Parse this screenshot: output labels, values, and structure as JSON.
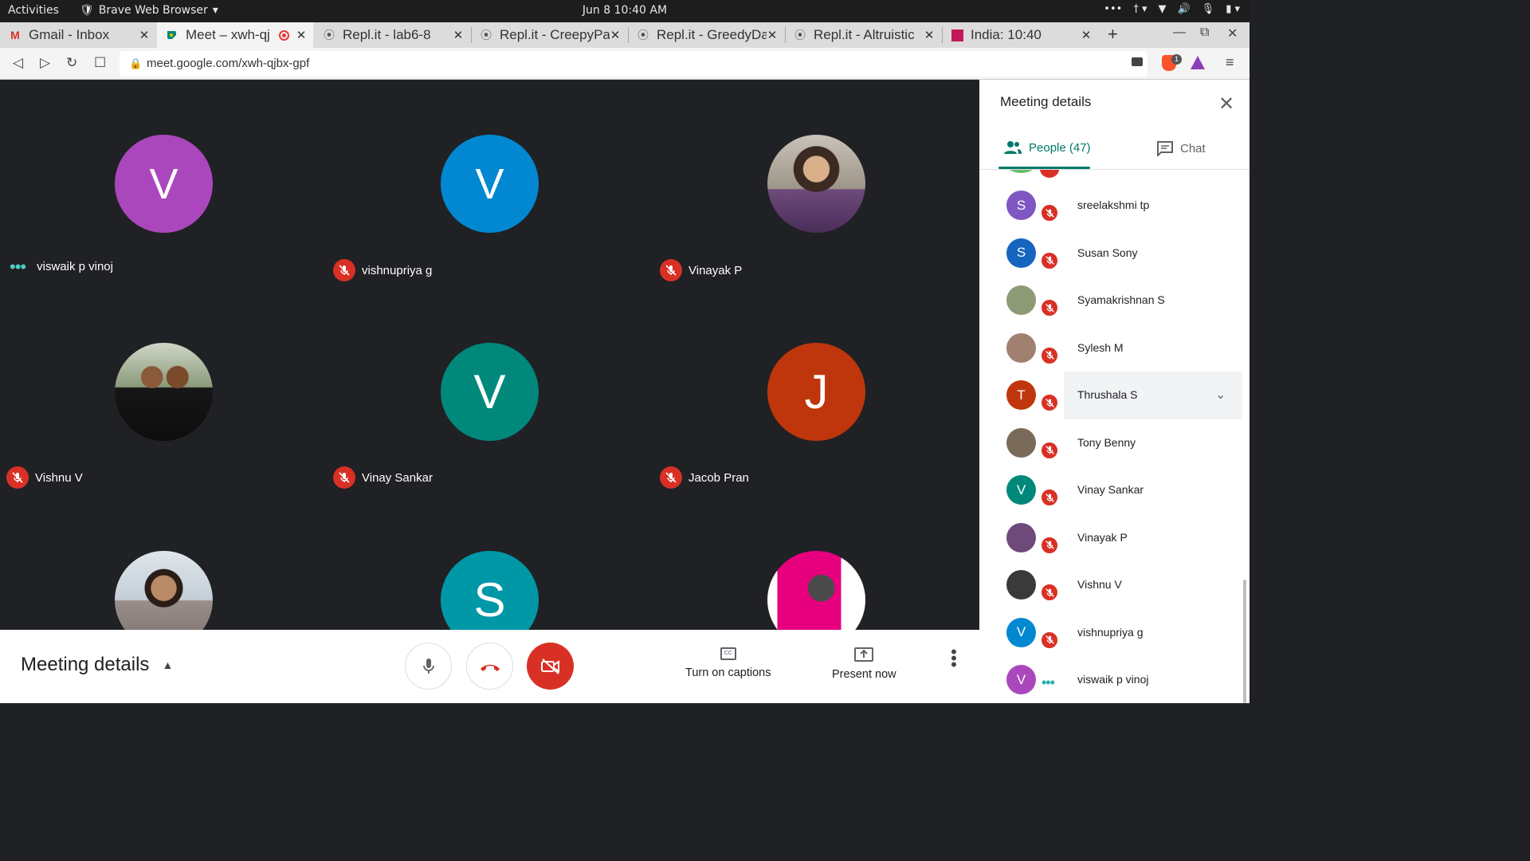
{
  "system": {
    "activities": "Activities",
    "app": "Brave Web Browser",
    "clock": "Jun 8  10:40 AM"
  },
  "tabs": [
    {
      "label": "Gmail - Inbox",
      "icon": "gmail-icon"
    },
    {
      "label": "Meet – xwh-qj",
      "icon": "meet-icon"
    },
    {
      "label": "Repl.it - lab6-8",
      "icon": "replit-icon"
    },
    {
      "label": "Repl.it - CreepyPa",
      "icon": "replit-icon"
    },
    {
      "label": "Repl.it - GreedyDa",
      "icon": "replit-icon"
    },
    {
      "label": "Repl.it - Altruistic",
      "icon": "replit-icon"
    },
    {
      "label": "India: 10:40",
      "icon": "clock-site-icon"
    }
  ],
  "address": {
    "url": "meet.google.com/xwh-qjbx-gpf",
    "brave_badge": "1"
  },
  "grid": {
    "tiles": [
      {
        "initial": "V",
        "name": "viswaik p vinoj",
        "color": "#ab47bc",
        "status": "speaking-dots"
      },
      {
        "initial": "V",
        "name": "vishnupriya g",
        "color": "#0288d1",
        "status": "muted"
      },
      {
        "initial": "",
        "name": "Vinayak P",
        "color": "#6d4a7a",
        "status": "muted"
      },
      {
        "initial": "",
        "name": "Vishnu V",
        "color": "#333333",
        "status": "muted"
      },
      {
        "initial": "V",
        "name": "Vinay Sankar",
        "color": "#00897b",
        "status": "muted"
      },
      {
        "initial": "J",
        "name": "Jacob Pran",
        "color": "#bf360c",
        "status": "muted"
      },
      {
        "initial": "",
        "name": "",
        "color": "#9a8e8a",
        "status": "none"
      },
      {
        "initial": "S",
        "name": "",
        "color": "#0097a7",
        "status": "none"
      },
      {
        "initial": "",
        "name": "",
        "color": "#e6007e",
        "status": "none"
      }
    ]
  },
  "bottom": {
    "meeting_details": "Meeting details",
    "captions": "Turn on captions",
    "captions_icon": "CC",
    "present": "Present now"
  },
  "panel": {
    "title": "Meeting details",
    "people_tab": "People (47)",
    "chat_tab": "Chat",
    "people": [
      {
        "initial": "S",
        "name": "sreelakshmi tp",
        "color": "#7e57c2",
        "status": "muted"
      },
      {
        "initial": "S",
        "name": "Susan Sony",
        "color": "#1565c0",
        "status": "muted"
      },
      {
        "initial": "",
        "name": "Syamakrishnan S",
        "color": "#8d9a76",
        "status": "muted"
      },
      {
        "initial": "",
        "name": "Sylesh M",
        "color": "#a08070",
        "status": "muted"
      },
      {
        "initial": "T",
        "name": "Thrushala S",
        "color": "#bf360c",
        "status": "muted"
      },
      {
        "initial": "",
        "name": "Tony Benny",
        "color": "#7a6a5a",
        "status": "muted"
      },
      {
        "initial": "V",
        "name": "Vinay Sankar",
        "color": "#00897b",
        "status": "muted"
      },
      {
        "initial": "",
        "name": "Vinayak P",
        "color": "#6d4a7a",
        "status": "muted"
      },
      {
        "initial": "",
        "name": "Vishnu V",
        "color": "#3a3a3a",
        "status": "muted"
      },
      {
        "initial": "V",
        "name": "vishnupriya g",
        "color": "#0288d1",
        "status": "muted"
      },
      {
        "initial": "V",
        "name": "viswaik p vinoj",
        "color": "#ab47bc",
        "status": "speaking-dots"
      }
    ]
  }
}
